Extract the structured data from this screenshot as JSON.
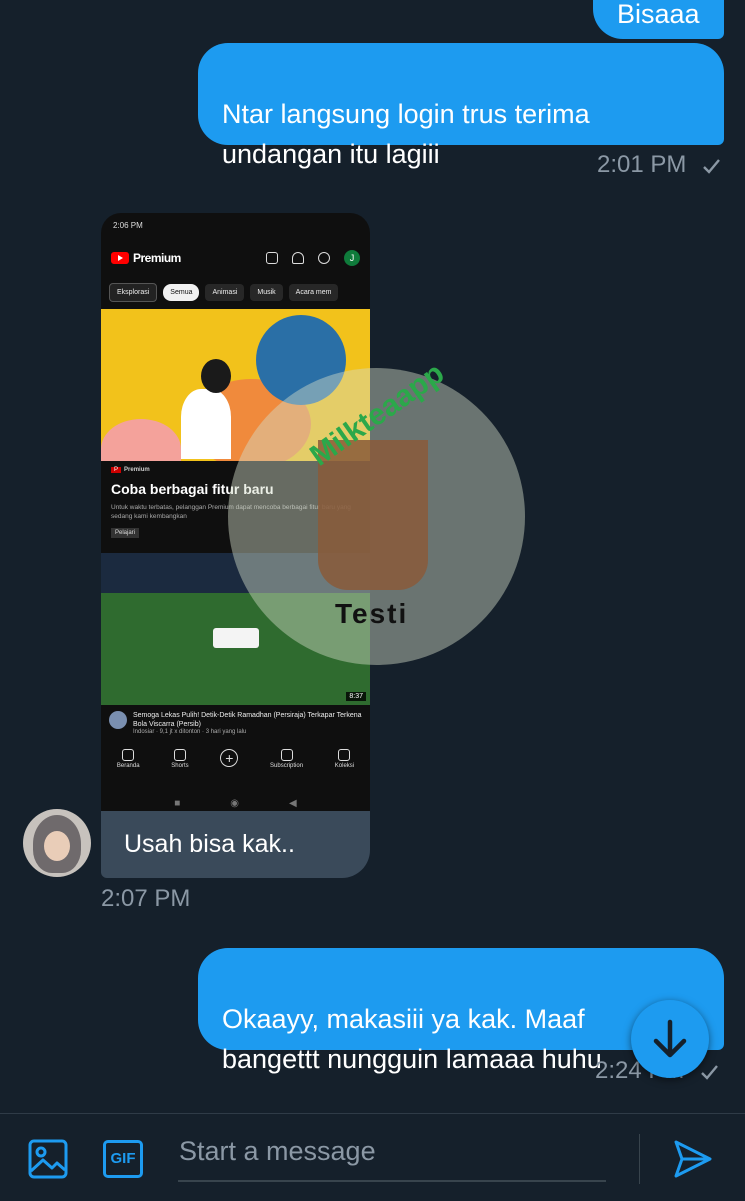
{
  "messages": [
    {
      "text": "Bisaaa"
    },
    {
      "text": "Ntar langsung login trus terima\nundangan itu lagiii",
      "time": "2:01 PM"
    },
    {
      "text": "Usah bisa kak..",
      "time": "2:07 PM"
    },
    {
      "text": "Okaayy, makasiii ya kak. Maaf\nbangettt nungguin lamaaa huhu",
      "time": "2:24 PM"
    }
  ],
  "attachment": {
    "status_time": "2:06 PM",
    "app_title": "Premium",
    "avatar_letter": "J",
    "chips": [
      "Eksplorasi",
      "Semua",
      "Animasi",
      "Musik",
      "Acara mem"
    ],
    "promo_badge": "Premium",
    "promo_title": "Coba berbagai fitur baru",
    "promo_desc": "Untuk waktu terbatas, pelanggan Premium dapat mencoba berbagai fitur baru yang sedang kami kembangkan",
    "promo_button": "Pelajari",
    "video_duration": "8:37",
    "video_title": "Semoga Lekas Pulih! Detik-Detik Ramadhan (Persiraja) Terkapar Terkena Bola Viscarra (Persib)",
    "video_meta": "Indosiar · 9,1 jt x ditonton · 3 hari yang lalu",
    "nav": [
      "Beranda",
      "Shorts",
      "",
      "Subscription",
      "Koleksi"
    ]
  },
  "watermark": {
    "brand": "Milkteaapp",
    "label": "Testi"
  },
  "composer": {
    "placeholder": "Start a message",
    "gif_label": "GIF"
  },
  "colors": {
    "background": "#15202b",
    "outgoing": "#1d9bf0",
    "incoming": "#3a4a5a",
    "meta": "#8b98a5"
  }
}
